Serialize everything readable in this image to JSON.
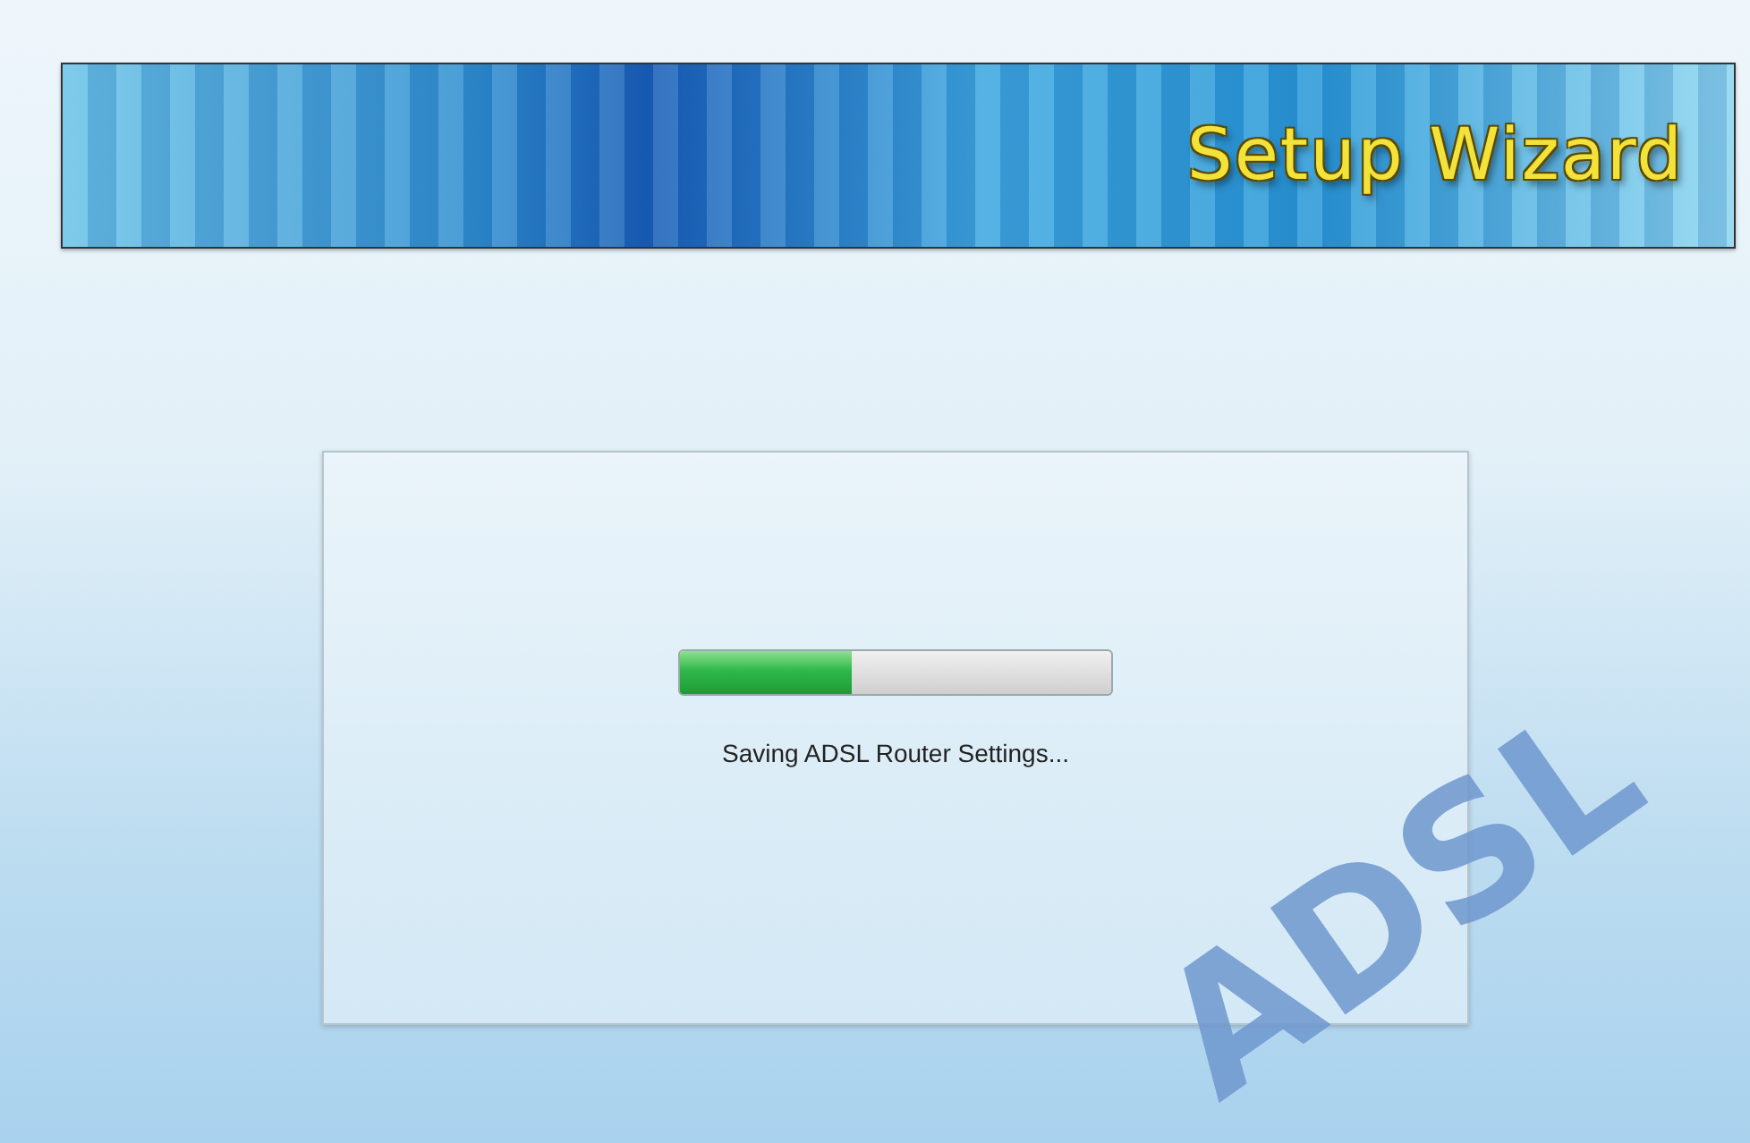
{
  "banner": {
    "title": "Setup Wizard"
  },
  "background_logo": "ADSL",
  "progress": {
    "level": 0.4,
    "message": "Saving ADSL Router Settings..."
  }
}
